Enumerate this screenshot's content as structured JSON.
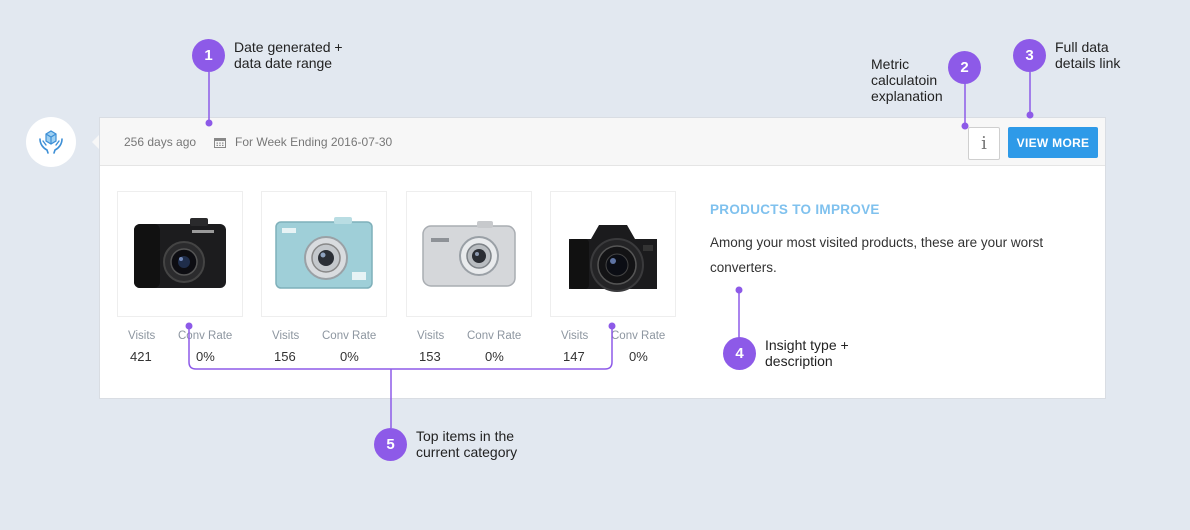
{
  "header": {
    "age": "256 days ago",
    "date_range": "For Week Ending 2016-07-30",
    "info_label": "i",
    "view_more_label": "VIEW MORE"
  },
  "insight": {
    "title": "PRODUCTS TO IMPROVE",
    "description": "Among your most visited products, these are your worst converters."
  },
  "products": [
    {
      "visits_label": "Visits",
      "visits": "421",
      "conv_label": "Conv Rate",
      "conv": "0%"
    },
    {
      "visits_label": "Visits",
      "visits": "156",
      "conv_label": "Conv Rate",
      "conv": "0%"
    },
    {
      "visits_label": "Visits",
      "visits": "153",
      "conv_label": "Conv Rate",
      "conv": "0%"
    },
    {
      "visits_label": "Visits",
      "visits": "147",
      "conv_label": "Conv Rate",
      "conv": "0%"
    }
  ],
  "annotations": [
    {
      "number": "1",
      "line1": "Date generated +",
      "line2": "data date range"
    },
    {
      "number": "2",
      "line1": "Metric",
      "line2": "calculatoin",
      "line3": "explanation"
    },
    {
      "number": "3",
      "line1": "Full data",
      "line2": "details link"
    },
    {
      "number": "4",
      "line1": "Insight type +",
      "line2": "description"
    },
    {
      "number": "5",
      "line1": "Top items in the",
      "line2": "current category"
    }
  ],
  "colors": {
    "background": "#e2e8f0",
    "accent_button": "#2e9ae8",
    "insight_title": "#7fc1ee",
    "annotation": "#8d5ae8"
  }
}
